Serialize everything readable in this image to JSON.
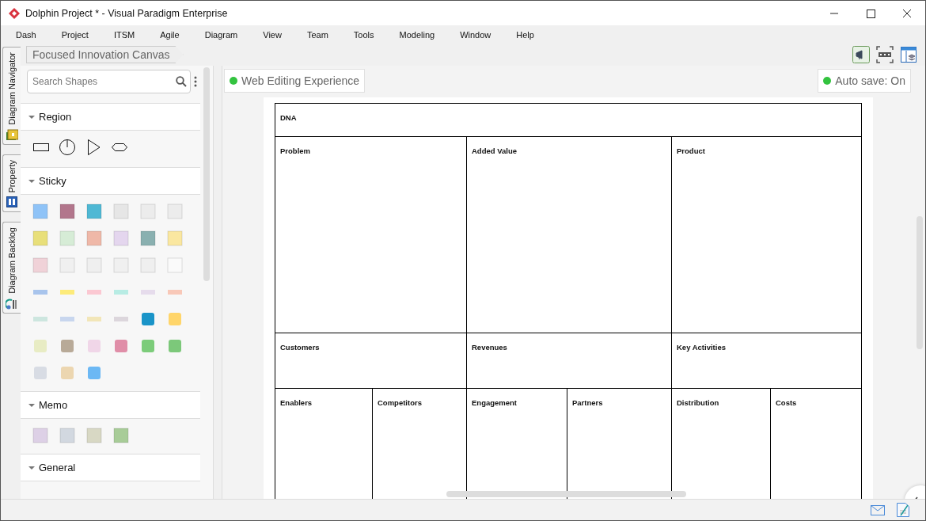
{
  "window": {
    "title": "Dolphin Project * - Visual Paradigm Enterprise"
  },
  "menu": [
    "Dash",
    "Project",
    "ITSM",
    "Agile",
    "Diagram",
    "View",
    "Team",
    "Tools",
    "Modeling",
    "Window",
    "Help"
  ],
  "side_tabs": [
    {
      "label": "Diagram Navigator",
      "kind": "navigator"
    },
    {
      "label": "Property",
      "kind": "property"
    },
    {
      "label": "Diagram Backlog",
      "kind": "backlog"
    }
  ],
  "breadcrumb": "Focused Innovation Canvas",
  "palette": {
    "search": {
      "placeholder": "Search Shapes"
    },
    "sections": [
      {
        "title": "Region",
        "expanded": true,
        "kind": "region"
      },
      {
        "title": "Sticky",
        "expanded": true,
        "kind": "sticky"
      },
      {
        "title": "Memo",
        "expanded": true,
        "kind": "memo"
      },
      {
        "title": "General",
        "expanded": true,
        "kind": "none"
      }
    ]
  },
  "canvas": {
    "status": "Web Editing Experience",
    "autosave": "Auto save: On",
    "bands": [
      {
        "blocks": [
          {
            "label": "DNA"
          }
        ]
      },
      {
        "blocks": [
          {
            "label": "Problem"
          },
          {
            "label": "Added Value"
          },
          {
            "label": "Product"
          }
        ]
      },
      {
        "blocks": [
          {
            "label": "Customers"
          },
          {
            "label": "Revenues"
          },
          {
            "label": "Key Activities"
          }
        ]
      },
      {
        "blocks": [
          {
            "label": "Enablers"
          },
          {
            "label": "Competitors"
          },
          {
            "label": "Engagement"
          },
          {
            "label": "Partners"
          },
          {
            "label": "Distribution"
          },
          {
            "label": "Costs"
          }
        ]
      }
    ]
  }
}
